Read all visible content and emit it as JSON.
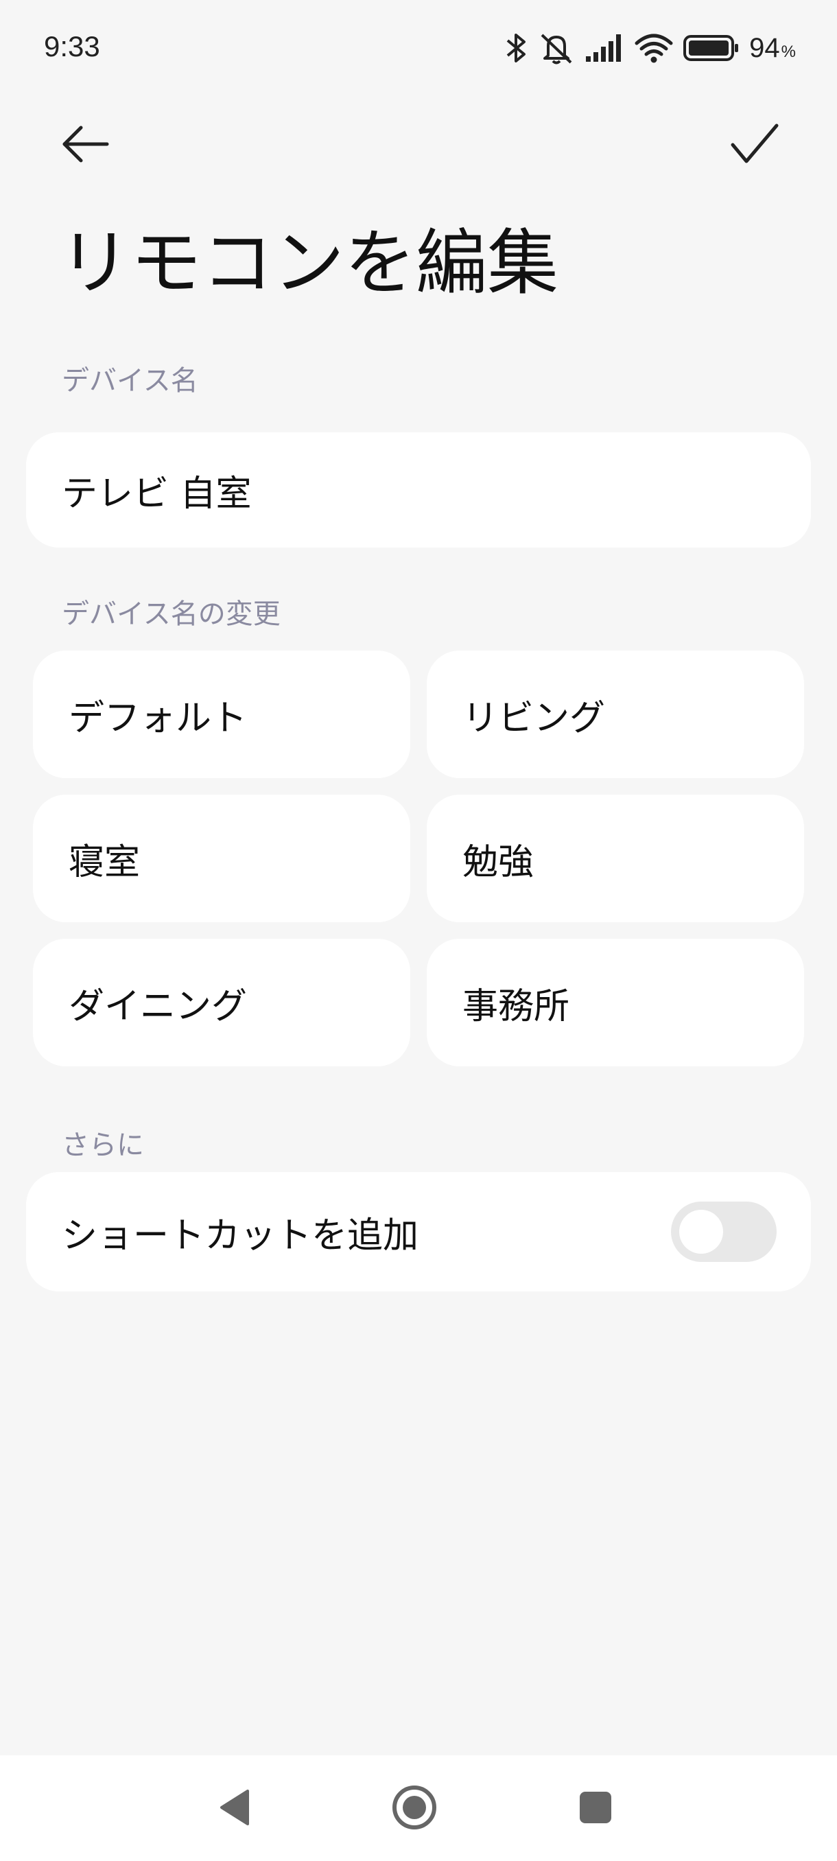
{
  "status_bar": {
    "time": "9:33",
    "battery_percent": "94",
    "battery_percent_sign": "%",
    "icons": [
      "bluetooth-icon",
      "silent-icon",
      "signal-icon",
      "wifi-icon",
      "battery-icon"
    ]
  },
  "top_bar": {
    "back_icon": "arrow-left-icon",
    "confirm_icon": "checkmark-icon"
  },
  "page": {
    "title": "リモコンを編集"
  },
  "device_name": {
    "label": "デバイス名",
    "value": "テレビ 自室"
  },
  "rename": {
    "label": "デバイス名の変更",
    "presets": [
      "デフォルト",
      "リビング",
      "寝室",
      "勉強",
      "ダイニング",
      "事務所"
    ]
  },
  "more": {
    "label": "さらに",
    "shortcut_label": "ショートカットを追加",
    "shortcut_enabled": false
  },
  "nav_bar": {
    "icons": [
      "back-triangle-icon",
      "home-circle-icon",
      "recents-square-icon"
    ]
  },
  "colors": {
    "background": "#f6f6f6",
    "card": "#ffffff",
    "section_label": "#8a8aa0",
    "toggle_off": "#e8e8e8"
  }
}
